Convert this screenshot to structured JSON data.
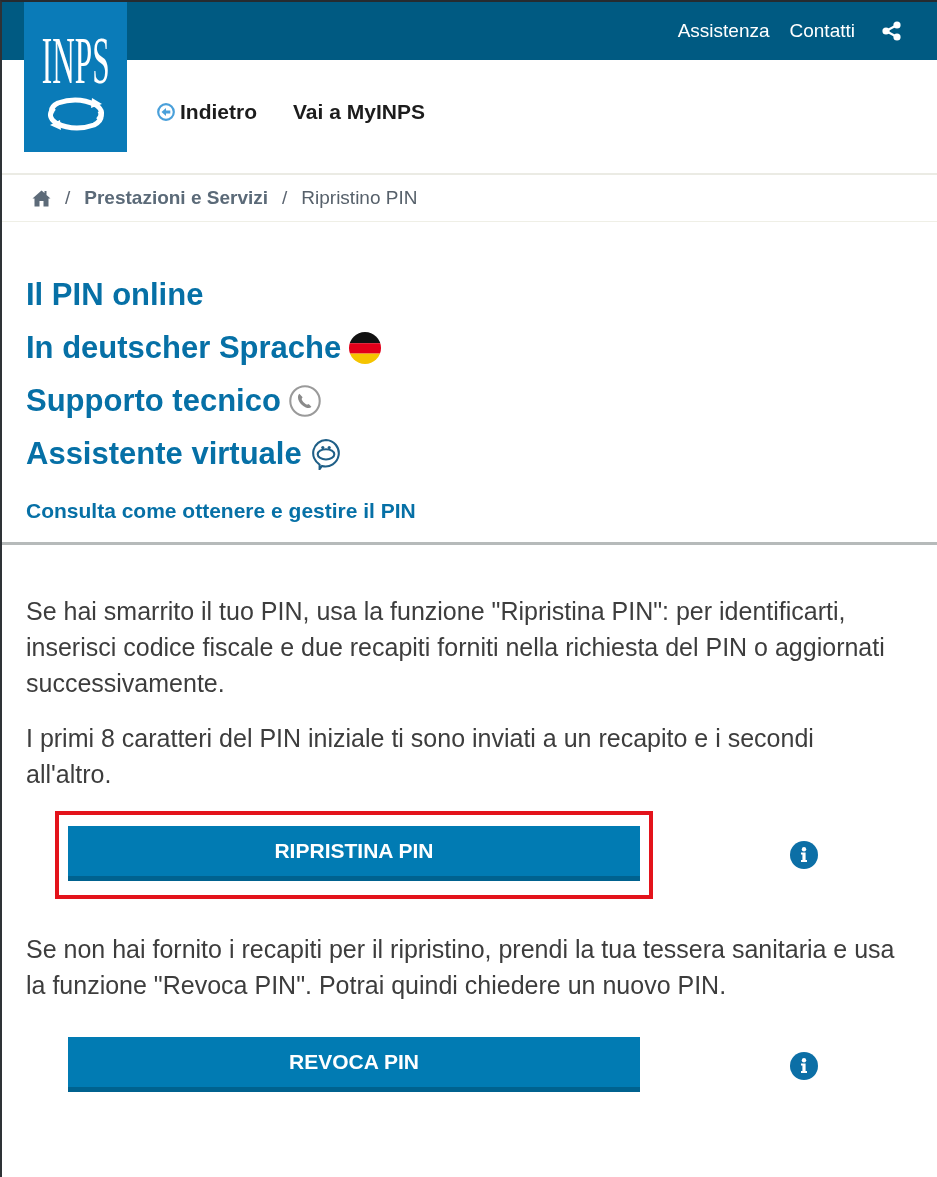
{
  "top_bar": {
    "links": [
      {
        "label": "Assistenza"
      },
      {
        "label": "Contatti"
      }
    ]
  },
  "logo": {
    "text": "INPS"
  },
  "nav": [
    {
      "label": "Indietro",
      "kind": "back"
    },
    {
      "label": "Vai a MyINPS",
      "kind": "plain"
    }
  ],
  "breadcrumb": {
    "separator": "/",
    "items": [
      {
        "kind": "home"
      },
      {
        "label": "Prestazioni e Servizi",
        "kind": "link"
      },
      {
        "label": "Ripristino PIN",
        "kind": "current"
      }
    ]
  },
  "quick_links": [
    {
      "label": "Il PIN online",
      "kind": "plain"
    },
    {
      "label": "In deutscher Sprache",
      "kind": "flag"
    },
    {
      "label": "Supporto tecnico",
      "kind": "phone"
    },
    {
      "label": "Assistente virtuale",
      "kind": "assistant"
    }
  ],
  "guide_link": "Consulta come ottenere e gestire il PIN",
  "content": [
    {
      "kind": "text",
      "text": "Se hai smarrito il tuo PIN, usa la funzione \"Ripristina PIN\": per identificarti, inserisci codice fiscale e due recapiti forniti nella richiesta del PIN o aggiornati successivamente."
    },
    {
      "kind": "text",
      "text": "I primi 8 caratteri del PIN iniziale ti sono inviati a un recapito e i secondi all'altro."
    },
    {
      "kind": "button",
      "label": "RIPRISTINA PIN",
      "highlighted": true
    },
    {
      "kind": "text",
      "text": "Se non hai fornito i recapiti per il ripristino, prendi la tua tessera sanitaria e usa la funzione \"Revoca PIN\". Potrai quindi chiedere un nuovo PIN."
    },
    {
      "kind": "button",
      "label": "REVOCA PIN",
      "highlighted": false
    }
  ]
}
